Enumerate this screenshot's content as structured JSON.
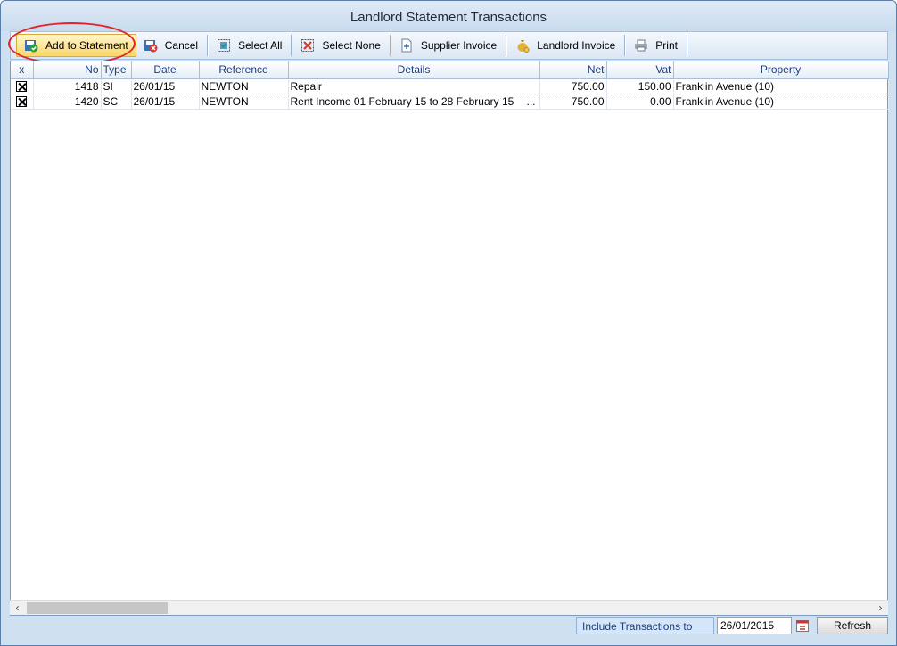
{
  "window": {
    "title": "Landlord Statement Transactions"
  },
  "toolbar": {
    "add_to_statement": "Add to Statement",
    "cancel": "Cancel",
    "select_all": "Select All",
    "select_none": "Select None",
    "supplier_invoice": "Supplier Invoice",
    "landlord_invoice": "Landlord Invoice",
    "print": "Print"
  },
  "grid": {
    "columns": {
      "x": "x",
      "no": "No",
      "type": "Type",
      "date": "Date",
      "reference": "Reference",
      "details": "Details",
      "net": "Net",
      "vat": "Vat",
      "property": "Property"
    },
    "rows": [
      {
        "checked": true,
        "no": "1418",
        "type": "SI",
        "date": "26/01/15",
        "reference": "NEWTON",
        "details": "Repair",
        "ellipsis": "",
        "net": "750.00",
        "vat": "150.00",
        "property": "Franklin Avenue (10)"
      },
      {
        "checked": true,
        "no": "1420",
        "type": "SC",
        "date": "26/01/15",
        "reference": "NEWTON",
        "details": "Rent Income 01 February 15 to 28 February 15",
        "ellipsis": "...",
        "net": "750.00",
        "vat": "0.00",
        "property": "Franklin Avenue (10)"
      }
    ]
  },
  "footer": {
    "include_label": "Include Transactions to",
    "date_value": "26/01/2015",
    "refresh": "Refresh"
  },
  "colors": {
    "accent": "#fbd769",
    "highlight": "#e0262c",
    "header_text": "#1d3c78"
  }
}
